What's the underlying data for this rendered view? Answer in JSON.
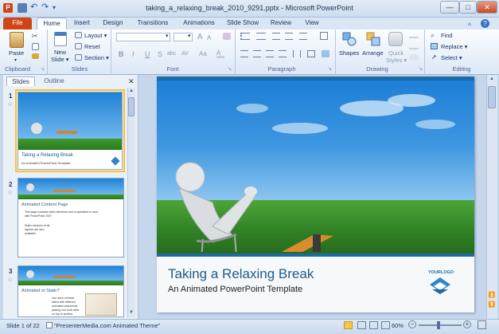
{
  "window": {
    "title": "taking_a_relaxing_break_2010_9291.pptx - Microsoft PowerPoint",
    "min_glyph": "—",
    "restore_glyph": "□",
    "close_glyph": "✕"
  },
  "ribbon_tabs": [
    "File",
    "Home",
    "Insert",
    "Design",
    "Transitions",
    "Animations",
    "Slide Show",
    "Review",
    "View"
  ],
  "groups": {
    "clipboard": {
      "label": "Clipboard",
      "paste": "Paste"
    },
    "slides": {
      "label": "Slides",
      "new_slide_1": "New",
      "new_slide_2": "Slide ▾",
      "layout": "Layout ▾",
      "reset": "Reset",
      "section": "Section ▾"
    },
    "font": {
      "label": "Font",
      "bold": "B",
      "italic": "I",
      "underline": "U",
      "strike": "S",
      "shadow": "abc",
      "spacing": "AV",
      "case": "Aa",
      "size_up": "A",
      "size_down": "A"
    },
    "paragraph": {
      "label": "Paragraph"
    },
    "drawing": {
      "label": "Drawing",
      "shapes": "Shapes",
      "arrange": "Arrange",
      "quick_styles_1": "Quick",
      "quick_styles_2": "Styles ▾"
    },
    "editing": {
      "label": "Editing",
      "find": "Find",
      "replace": "Replace ▾",
      "select": "Select ▾"
    }
  },
  "pane": {
    "tab_slides": "Slides",
    "tab_outline": "Outline",
    "close": "✕"
  },
  "thumbnails": [
    {
      "num": "1",
      "title": "Taking a Relaxing Break",
      "subtitle": "An Animated PowerPoint Template"
    },
    {
      "num": "2",
      "title": "Animated Content Page",
      "lines": [
        "This page contains video elements and is optimized to work",
        "with PowerPoint 2007.",
        "",
        "Static versions of all",
        "layouts are also",
        "available."
      ]
    },
    {
      "num": "3",
      "title": "Animated or Static?",
      "lines": [
        "Use each of these",
        "slides with different",
        "animated sequences,",
        "placing one such slide",
        "on top of another."
      ]
    }
  ],
  "slide": {
    "title": "Taking a Relaxing Break",
    "subtitle": "An Animated PowerPoint Template",
    "logo_text": "YOURLOGO"
  },
  "status": {
    "slide_info": "Slide 1 of 22",
    "theme": "\"PresenterMedia.com Animated Theme\"",
    "zoom": "60%"
  },
  "colors": {
    "file_tab": "#d14418",
    "title_text": "#1f5c8a",
    "accent_bar": "#1c6aa6"
  }
}
